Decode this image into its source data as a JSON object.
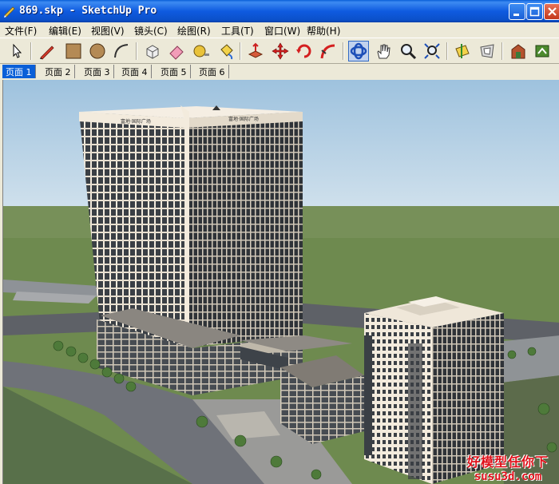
{
  "window": {
    "title": "869.skp - SketchUp Pro"
  },
  "menu": [
    "文件(F)",
    "编辑(E)",
    "视图(V)",
    "镜头(C)",
    "绘图(R)",
    "工具(T)",
    "窗口(W)",
    "帮助(H)"
  ],
  "toolbar": {
    "tools": [
      "select-icon",
      "pencil-icon",
      "rectangle-icon",
      "circle-icon",
      "arc-icon",
      "make-component-icon",
      "eraser-icon",
      "tape-measure-icon",
      "paint-bucket-icon",
      "push-pull-icon",
      "move-icon",
      "rotate-icon",
      "follow-me-icon",
      "orbit-icon",
      "pan-icon",
      "zoom-icon",
      "zoom-extents-icon",
      "section-icon",
      "offset-icon",
      "warehouse-icon",
      "extension-icon"
    ]
  },
  "tabs": [
    "页面 1",
    "页面 2",
    "页面 3",
    "页面 4",
    "页面 5",
    "页面 6"
  ],
  "selected_tab": "页面 1",
  "building_signs": [
    "富地·国际广场",
    "富地·国际广场"
  ],
  "watermark": {
    "line1": "好模型任你下",
    "line2": "susu3d.com"
  },
  "colors": {
    "titlebar": "#0A5FD8",
    "sky": "#B8D3E6",
    "grass": "#6E8A4F",
    "road": "#6F7279",
    "facade": "#F3EBDD"
  }
}
